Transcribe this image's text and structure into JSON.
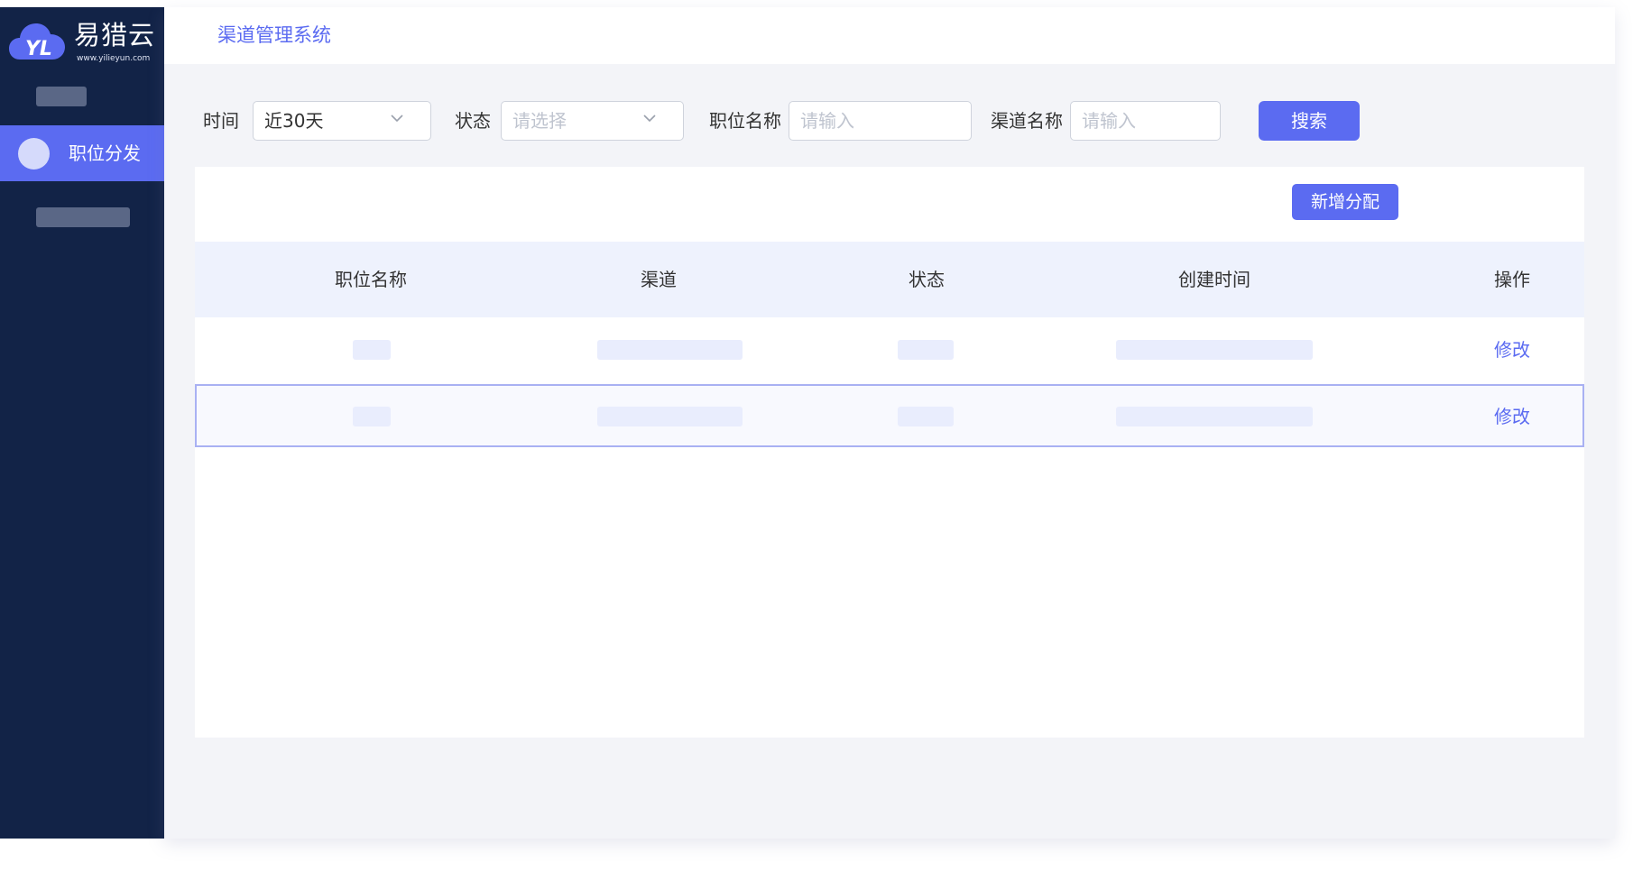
{
  "brand": {
    "logo_mark": "YL",
    "name": "易猎云",
    "url_text": "www.yilieyun.com",
    "accent_color": "#5b6bf1",
    "sidebar_color": "#122347"
  },
  "sidebar": {
    "active_item": {
      "label": "职位分发",
      "icon": "circle-icon"
    }
  },
  "header": {
    "title": "渠道管理系统"
  },
  "filters": {
    "time": {
      "label": "时间",
      "value": "近30天"
    },
    "status": {
      "label": "状态",
      "placeholder": "请选择"
    },
    "position_name": {
      "label": "职位名称",
      "placeholder": "请输入"
    },
    "channel_name": {
      "label": "渠道名称",
      "placeholder": "请输入"
    },
    "search_button": "搜索"
  },
  "table": {
    "add_button": "新增分配",
    "columns": [
      "职位名称",
      "渠道",
      "状态",
      "创建时间",
      "操作"
    ],
    "rows": [
      {
        "action": "修改",
        "selected": false
      },
      {
        "action": "修改",
        "selected": true
      }
    ]
  }
}
